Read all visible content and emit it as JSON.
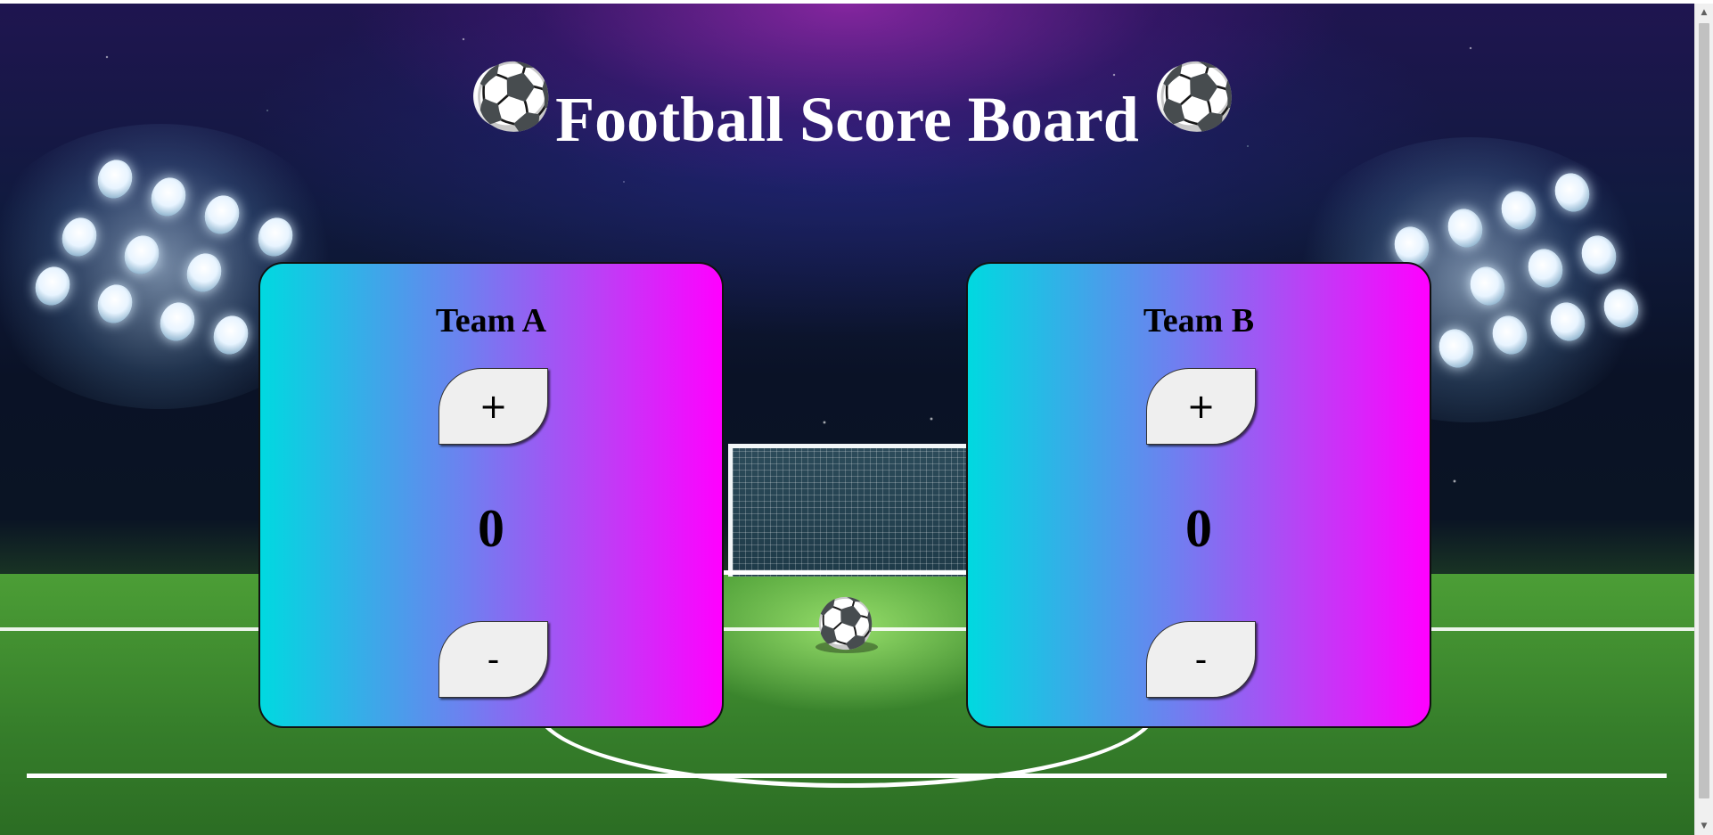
{
  "page": {
    "title": "Football Score Board",
    "title_icon": "soccer-ball-icon",
    "title_icon_glyph": "⚽"
  },
  "teams": [
    {
      "name": "Team A",
      "score": "0",
      "increment_label": "+",
      "decrement_label": "-"
    },
    {
      "name": "Team B",
      "score": "0",
      "increment_label": "+",
      "decrement_label": "-"
    }
  ],
  "scrollbar": {
    "up_arrow": "▲",
    "down_arrow": "▼"
  },
  "colors": {
    "card_gradient_start": "#00d9e0",
    "card_gradient_end": "#ff00ff",
    "button_bg": "#efefef",
    "title_color": "#ffffff"
  }
}
